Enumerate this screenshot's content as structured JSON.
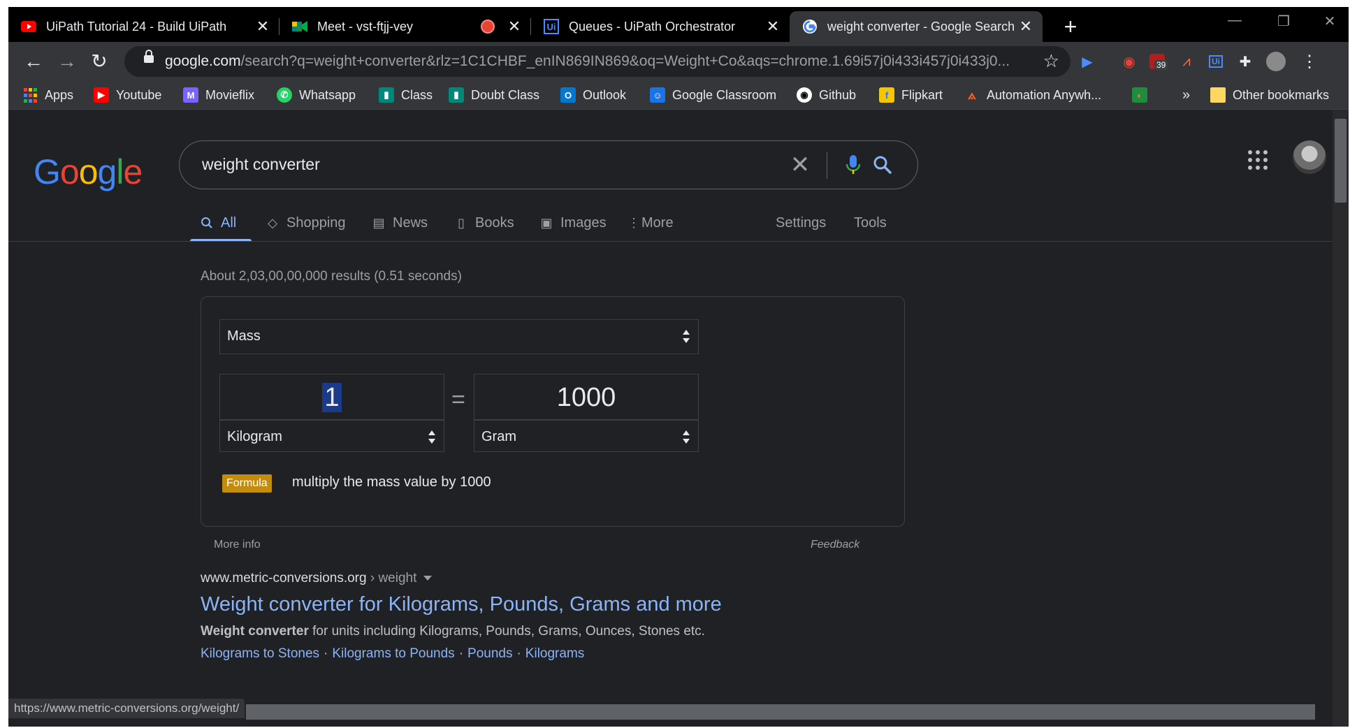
{
  "tabs": [
    {
      "title": "UiPath Tutorial 24 - Build UiPath",
      "icon": "youtube-icon"
    },
    {
      "title": "Meet - vst-ftjj-vey",
      "icon": "meet-icon"
    },
    {
      "title": "Queues - UiPath Orchestrator",
      "icon": "uipath-icon"
    },
    {
      "title": "weight converter - Google Search",
      "icon": "google-icon"
    }
  ],
  "omnibox": {
    "host": "google.com",
    "path": "/search?q=weight+converter&rlz=1C1CHBF_enIN869IN869&oq=Weight+Co&aqs=chrome.1.69i57j0i433i457j0i433j0..."
  },
  "extensions": {
    "badge_count": "39"
  },
  "bookmarks": [
    {
      "label": "Apps",
      "icon": "apps-grid-icon",
      "color": "#ea4335"
    },
    {
      "label": "Youtube",
      "icon": "youtube-icon",
      "color": "#ff0000"
    },
    {
      "label": "Movieflix",
      "icon": "movieflix-icon",
      "color": "#7b61ff"
    },
    {
      "label": "Whatsapp",
      "icon": "whatsapp-icon",
      "color": "#25d366"
    },
    {
      "label": "Class",
      "icon": "meet-icon",
      "color": "#00897b"
    },
    {
      "label": "Doubt Class",
      "icon": "meet-icon",
      "color": "#00897b"
    },
    {
      "label": "Outlook",
      "icon": "outlook-icon",
      "color": "#0078d4"
    },
    {
      "label": "Google Classroom",
      "icon": "classroom-icon",
      "color": "#1a73e8"
    },
    {
      "label": "Github",
      "icon": "github-icon",
      "color": "#ffffff"
    },
    {
      "label": "Flipkart",
      "icon": "flipkart-icon",
      "color": "#f7c600"
    },
    {
      "label": "Automation Anywh...",
      "icon": "automation-anywhere-icon",
      "color": "#ff5a1f"
    }
  ],
  "bookmarks_more": "»",
  "other_bookmarks": "Other bookmarks",
  "search": {
    "query": "weight converter"
  },
  "nav_tabs": {
    "all": "All",
    "shopping": "Shopping",
    "news": "News",
    "books": "Books",
    "images": "Images",
    "more": "More",
    "settings": "Settings",
    "tools": "Tools"
  },
  "result_stats": "About 2,03,00,00,000 results (0.51 seconds)",
  "converter": {
    "quantity": "Mass",
    "from_value": "1",
    "from_unit": "Kilogram",
    "equals": "=",
    "to_value": "1000",
    "to_unit": "Gram",
    "formula_label": "Formula",
    "formula_text": "multiply the mass value by 1000",
    "more_info": "More info",
    "feedback": "Feedback"
  },
  "result": {
    "site": "www.metric-conversions.org",
    "path": " › weight",
    "title": "Weight converter for Kilograms, Pounds, Grams and more",
    "snippet_bold": "Weight converter",
    "snippet_rest": " for units including Kilograms, Pounds, Grams, Ounces, Stones etc.",
    "links": [
      "Kilograms to Stones",
      "Kilograms to Pounds",
      "Pounds",
      "Kilograms"
    ],
    "link_separator": "·"
  },
  "status_url": "https://www.metric-conversions.org/weight/",
  "colors": {
    "accent": "#8ab4f8",
    "background": "#202124",
    "formula_badge": "#c38c0a"
  }
}
